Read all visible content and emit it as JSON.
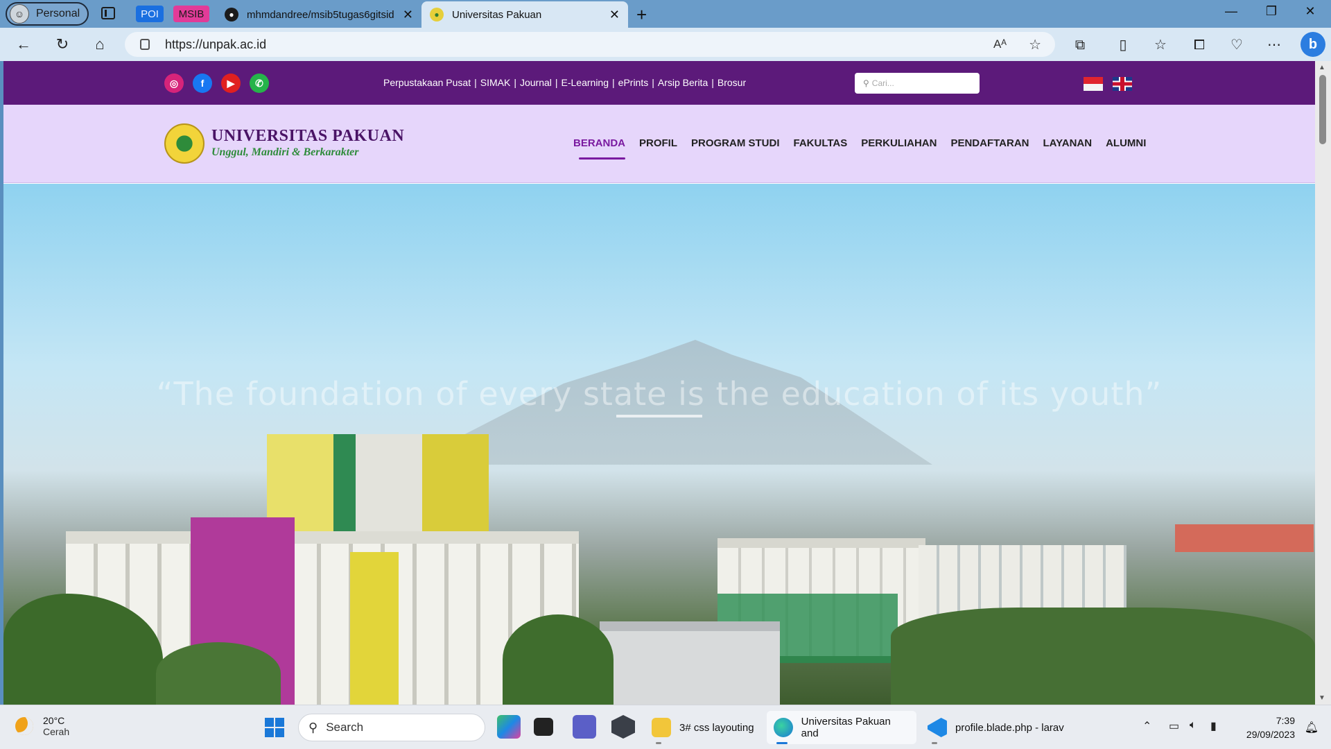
{
  "browser": {
    "profile_label": "Personal",
    "pinned": [
      "POI",
      "MSIB"
    ],
    "tabs": [
      {
        "title": "mhmdandree/msib5tugas6gitsid"
      },
      {
        "title": "Universitas Pakuan"
      }
    ],
    "url": "https://unpak.ac.id",
    "read_aloud": "Aᴬ",
    "window_controls": {
      "minimize": "—",
      "restore": "❐",
      "close": "✕"
    }
  },
  "site": {
    "toplinks": [
      "Perpustakaan Pusat",
      "SIMAK",
      "Journal",
      "E-Learning",
      "ePrints",
      "Arsip Berita",
      "Brosur"
    ],
    "search_placeholder": "Cari...",
    "logo_title": "UNIVERSITAS PAKUAN",
    "logo_tagline": "Unggul, Mandiri & Berkarakter",
    "nav": [
      "BERANDA",
      "PROFIL",
      "PROGRAM STUDI",
      "FAKULTAS",
      "PERKULIAHAN",
      "PENDAFTARAN",
      "LAYANAN",
      "ALUMNI"
    ],
    "active_nav": "BERANDA",
    "hero_quote": "“The foundation of every state is the education of its youth”",
    "colors": {
      "topbar": "#5c1a7a",
      "header": "#e6d6fb",
      "accent": "#7a1aa0"
    }
  },
  "taskbar": {
    "weather_temp": "20°C",
    "weather_desc": "Cerah",
    "search_label": "Search",
    "apps": [
      {
        "label": "3# css layouting"
      },
      {
        "label": "Universitas Pakuan and"
      },
      {
        "label": "profile.blade.php - larav"
      }
    ],
    "time": "7:39",
    "date": "29/09/2023"
  }
}
